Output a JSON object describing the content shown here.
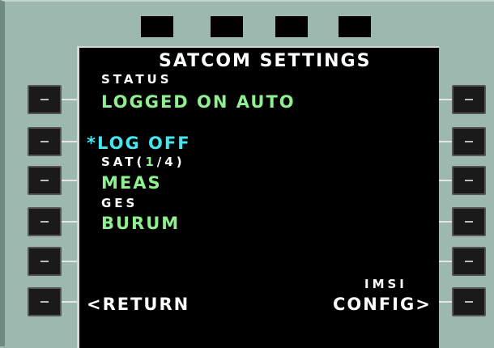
{
  "title": "SATCOM SETTINGS",
  "lines": {
    "status_label": "STATUS",
    "status_value": "LOGGED ON AUTO",
    "log_off": "*LOG OFF",
    "sat_label_prefix": "SAT(",
    "sat_label_current": "1",
    "sat_label_suffix": "/4)",
    "sat_value": "MEAS",
    "ges_label": "GES",
    "ges_value": "BURUM",
    "return": "<RETURN",
    "imsi_label": "IMSI",
    "config": "CONFIG>"
  },
  "colors": {
    "bezel": "#9db8af",
    "screen": "#000000",
    "green": "#8ff08f",
    "cyan": "#45e6ee",
    "white": "#ffffff"
  }
}
